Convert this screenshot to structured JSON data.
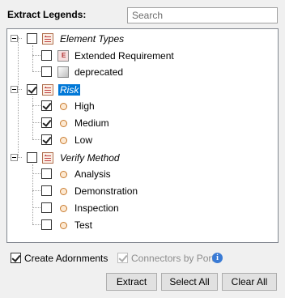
{
  "header": {
    "title": "Extract Legends:",
    "search_placeholder": "Search"
  },
  "tree": {
    "groups": [
      {
        "label": "Element Types",
        "checked": false,
        "children": [
          {
            "label": "Extended Requirement",
            "icon": "requirement-icon",
            "checked": false
          },
          {
            "label": "deprecated",
            "icon": "deprecated-icon",
            "checked": false
          }
        ]
      },
      {
        "label": "Risk",
        "checked": true,
        "selected": true,
        "children": [
          {
            "label": "High",
            "icon": "circle-icon",
            "checked": true
          },
          {
            "label": "Medium",
            "icon": "circle-icon",
            "checked": true
          },
          {
            "label": "Low",
            "icon": "circle-icon",
            "checked": true
          }
        ]
      },
      {
        "label": "Verify Method",
        "checked": false,
        "children": [
          {
            "label": "Analysis",
            "icon": "circle-icon",
            "checked": false
          },
          {
            "label": "Demonstration",
            "icon": "circle-icon",
            "checked": false
          },
          {
            "label": "Inspection",
            "icon": "circle-icon",
            "checked": false
          },
          {
            "label": "Test",
            "icon": "circle-icon",
            "checked": false
          }
        ]
      }
    ],
    "requirement_icon_letter": "E"
  },
  "options": {
    "create_adornments_label": "Create Adornments",
    "create_adornments_checked": true,
    "connectors_by_ports_label": "Connectors by Ports",
    "connectors_by_ports_checked": true,
    "connectors_by_ports_enabled": false,
    "info_glyph": "i"
  },
  "buttons": {
    "extract": "Extract",
    "select_all": "Select All",
    "clear_all": "Clear All"
  },
  "colors": {
    "selection": "#0078d7",
    "info": "#3a7bd5"
  }
}
